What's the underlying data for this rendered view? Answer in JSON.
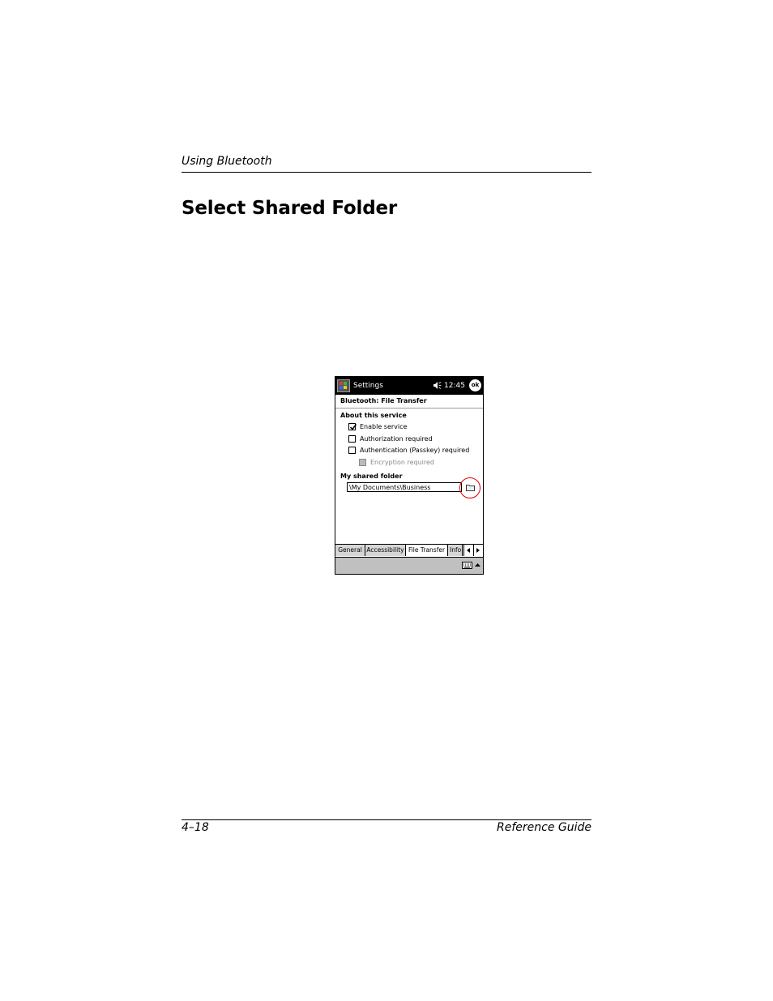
{
  "page": {
    "running_header": "Using Bluetooth",
    "title": "Select Shared Folder",
    "page_number": "4–18",
    "book_title": "Reference Guide"
  },
  "device": {
    "nav_title": "Settings",
    "clock": "12:45",
    "ok_label": "ok",
    "heading": "Bluetooth: File Transfer",
    "about_label": "About this service",
    "options": [
      {
        "label": "Enable service",
        "checked": true,
        "enabled": true
      },
      {
        "label": "Authorization required",
        "checked": false,
        "enabled": true
      },
      {
        "label": "Authentication (Passkey) required",
        "checked": false,
        "enabled": true
      },
      {
        "label": "Encryption required",
        "checked": false,
        "enabled": false
      }
    ],
    "folder_label": "My shared folder",
    "folder_value": "\\My Documents\\Business",
    "tabs": [
      "General",
      "Accessibility",
      "File Transfer",
      "Info"
    ],
    "active_tab": "File Transfer",
    "highlight_color": "#dd0000"
  }
}
